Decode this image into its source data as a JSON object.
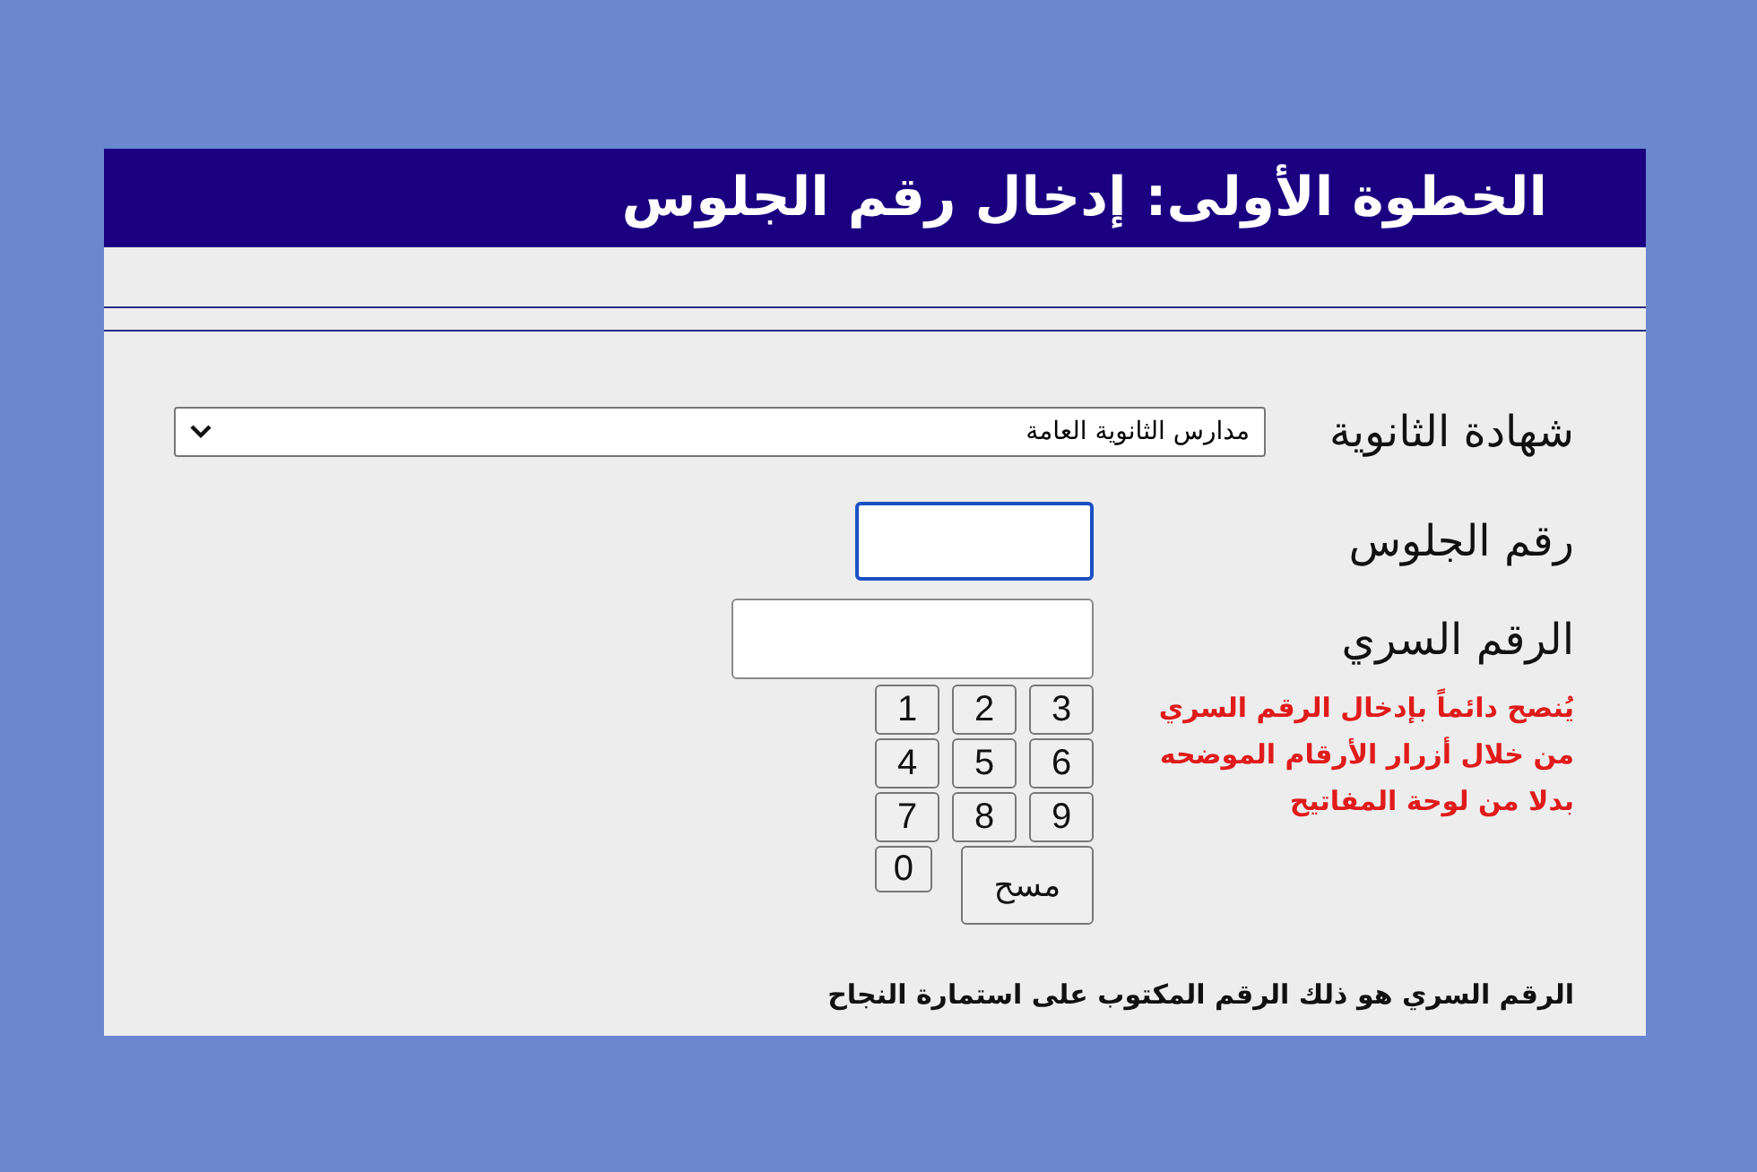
{
  "header": {
    "title": "الخطوة الأولى: إدخال رقم الجلوس"
  },
  "certificate": {
    "label": "شهادة الثانوية",
    "value": "مدارس الثانوية العامة"
  },
  "seat_number": {
    "label": "رقم الجلوس",
    "focused": true
  },
  "secret_number": {
    "label": "الرقم السري",
    "focused": false
  },
  "keypad": {
    "rows": [
      [
        "3",
        "2",
        "1"
      ],
      [
        "6",
        "5",
        "4"
      ],
      [
        "9",
        "8",
        "7"
      ]
    ],
    "clear": "مسح",
    "zero": "0"
  },
  "note": "يُنصح دائماً بإدخال الرقم السري من خلال أزرار الأرقام الموضحه بدلا من لوحة المفاتيح",
  "footer": "الرقم السري هو ذلك الرقم المكتوب على استمارة النجاح"
}
